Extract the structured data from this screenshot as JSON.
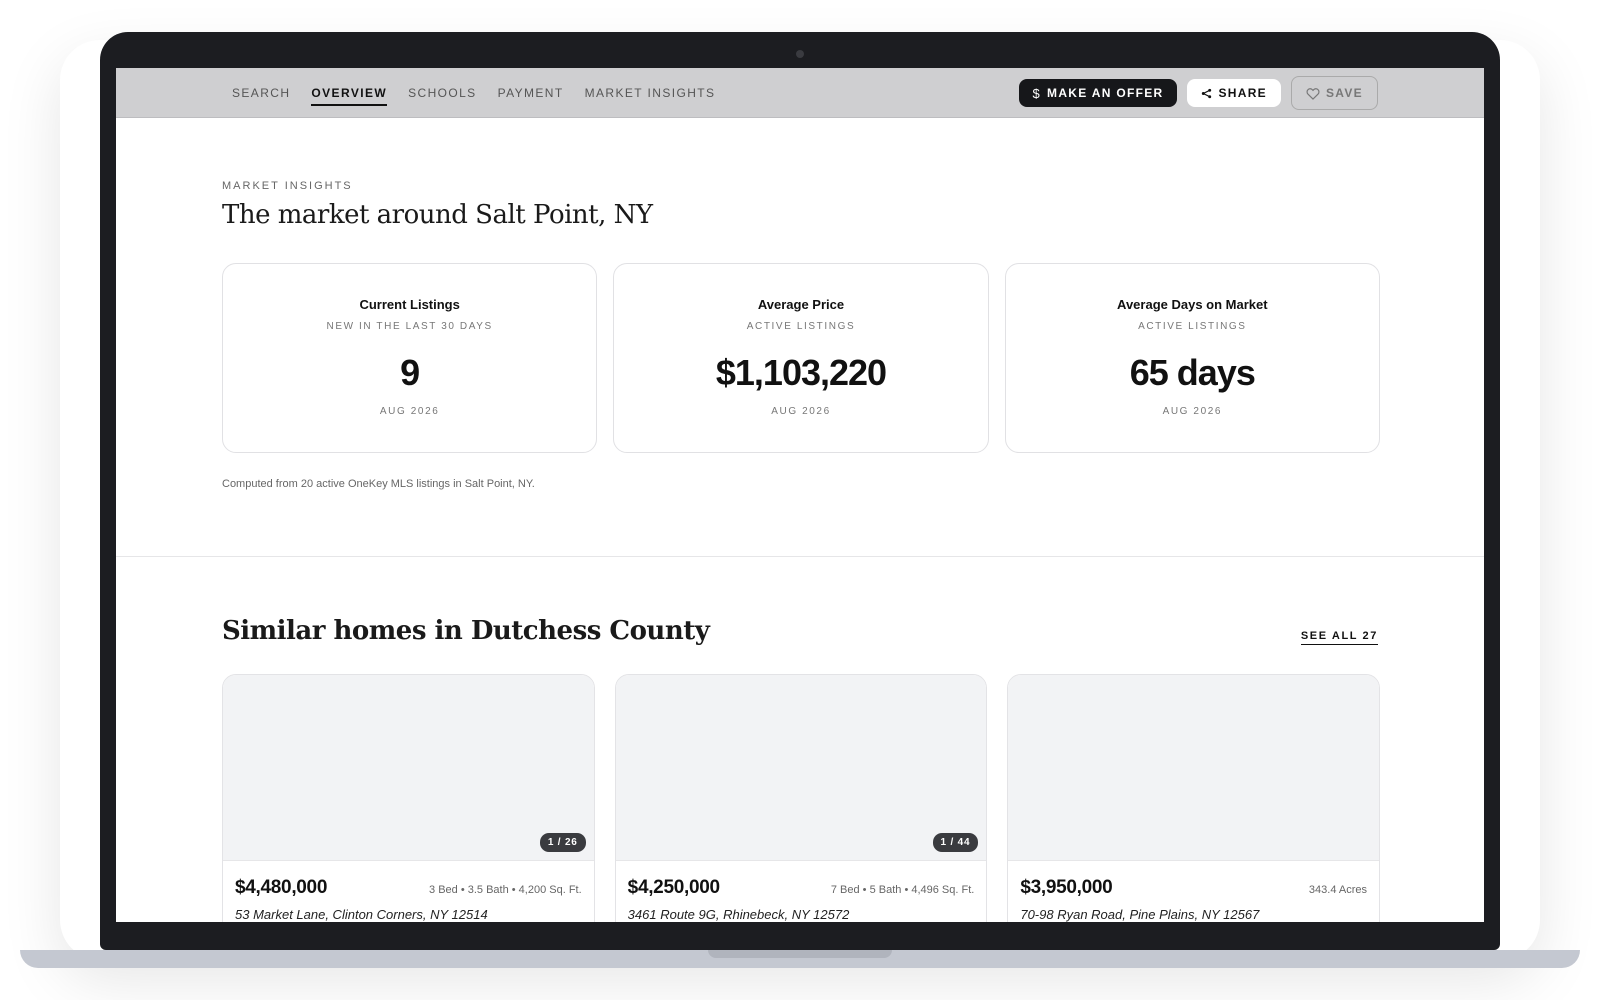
{
  "nav": {
    "links": [
      {
        "label": "SEARCH",
        "active": false
      },
      {
        "label": "OVERVIEW",
        "active": true
      },
      {
        "label": "SCHOOLS",
        "active": false
      },
      {
        "label": "PAYMENT",
        "active": false
      },
      {
        "label": "MARKET INSIGHTS",
        "active": false
      }
    ],
    "make_offer_label": "MAKE AN OFFER",
    "share_label": "SHARE",
    "save_label": "SAVE"
  },
  "market": {
    "eyebrow": "MARKET INSIGHTS",
    "title": "The market around Salt Point, NY",
    "stats": [
      {
        "label": "Current Listings",
        "sub": "NEW IN THE LAST 30 DAYS",
        "value": "9",
        "date": "AUG 2026"
      },
      {
        "label": "Average Price",
        "sub": "ACTIVE LISTINGS",
        "value": "$1,103,220",
        "date": "AUG 2026"
      },
      {
        "label": "Average Days on Market",
        "sub": "ACTIVE LISTINGS",
        "value": "65 days",
        "date": "AUG 2026"
      }
    ],
    "footnote": "Computed from 20 active OneKey MLS listings in Salt Point, NY."
  },
  "similar": {
    "title": "Similar homes in Dutchess County",
    "see_all_label": "SEE ALL 27",
    "homes": [
      {
        "photo_count": "1 / 26",
        "price": "$4,480,000",
        "meta": "3 Bed • 3.5 Bath • 4,200 Sq. Ft.",
        "address": "53 Market Lane, Clinton Corners, NY 12514"
      },
      {
        "photo_count": "1 / 44",
        "price": "$4,250,000",
        "meta": "7 Bed • 5 Bath • 4,496 Sq. Ft.",
        "address": "3461 Route 9G, Rhinebeck, NY 12572"
      },
      {
        "photo_count": "",
        "price": "$3,950,000",
        "meta": "343.4 Acres",
        "address": "70-98 Ryan Road, Pine Plains, NY 12567"
      }
    ]
  },
  "icons": {
    "offer": "dollar-icon",
    "share": "share-icon",
    "save": "heart-icon"
  }
}
